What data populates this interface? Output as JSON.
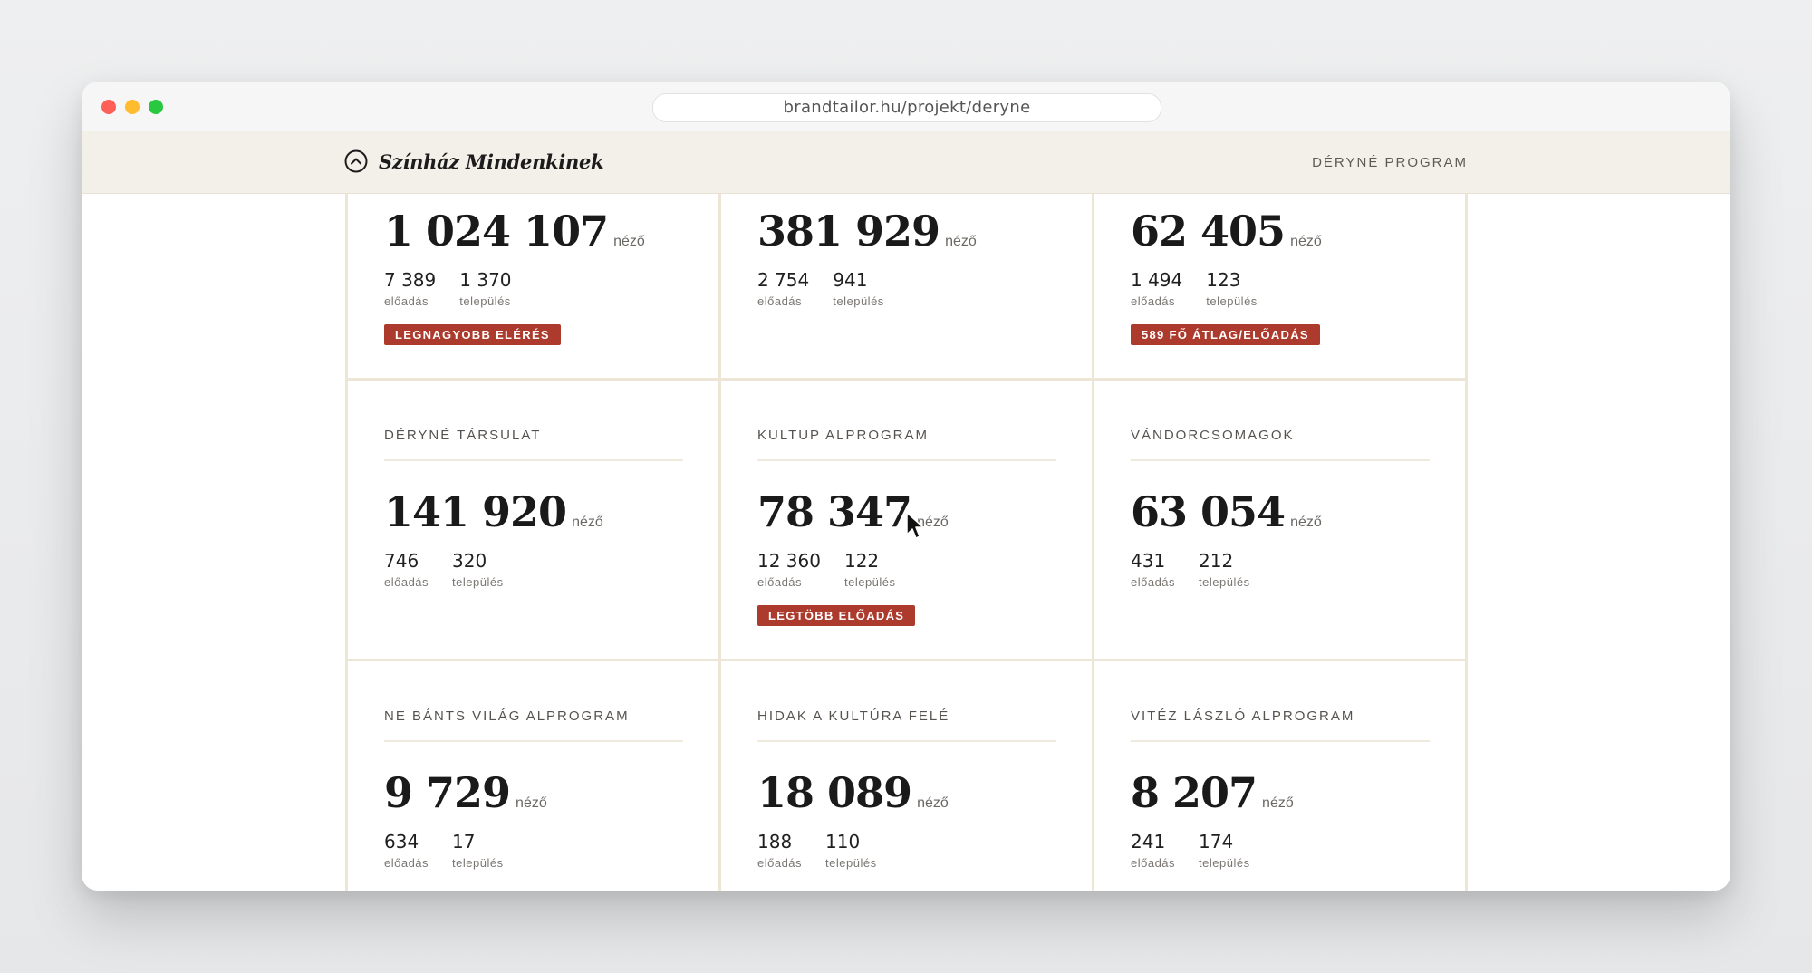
{
  "browser": {
    "url": "brandtailor.hu/projekt/deryne"
  },
  "site": {
    "brand_name": "Színház Mindenkinek",
    "nav_link": "DÉRYNÉ PROGRAM"
  },
  "cards": [
    {
      "title": "",
      "viewers": "1 024 107",
      "unit": "néző",
      "performances": "7 389",
      "performances_label": "előadás",
      "settlements": "1 370",
      "settlements_label": "település",
      "badge": "LEGNAGYOBB ELÉRÉS"
    },
    {
      "title": "",
      "viewers": "381 929",
      "unit": "néző",
      "performances": "2 754",
      "performances_label": "előadás",
      "settlements": "941",
      "settlements_label": "település",
      "badge": ""
    },
    {
      "title": "",
      "viewers": "62 405",
      "unit": "néző",
      "performances": "1 494",
      "performances_label": "előadás",
      "settlements": "123",
      "settlements_label": "település",
      "badge": "589 FŐ ÁTLAG/ELŐADÁS"
    },
    {
      "title": "DÉRYNÉ TÁRSULAT",
      "viewers": "141 920",
      "unit": "néző",
      "performances": "746",
      "performances_label": "előadás",
      "settlements": "320",
      "settlements_label": "település",
      "badge": ""
    },
    {
      "title": "KULTUP ALPROGRAM",
      "viewers": "78 347",
      "unit": "néző",
      "performances": "12 360",
      "performances_label": "előadás",
      "settlements": "122",
      "settlements_label": "település",
      "badge": "LEGTÖBB ELŐADÁS"
    },
    {
      "title": "VÁNDORCSOMAGOK",
      "viewers": "63 054",
      "unit": "néző",
      "performances": "431",
      "performances_label": "előadás",
      "settlements": "212",
      "settlements_label": "település",
      "badge": ""
    },
    {
      "title": "NE BÁNTS VILÁG ALPROGRAM",
      "viewers": "9 729",
      "unit": "néző",
      "performances": "634",
      "performances_label": "előadás",
      "settlements": "17",
      "settlements_label": "település",
      "badge": ""
    },
    {
      "title": "HIDAK A KULTÚRA FELÉ",
      "viewers": "18 089",
      "unit": "néző",
      "performances": "188",
      "performances_label": "előadás",
      "settlements": "110",
      "settlements_label": "település",
      "badge": ""
    },
    {
      "title": "VITÉZ LÁSZLÓ ALPROGRAM",
      "viewers": "8 207",
      "unit": "néző",
      "performances": "241",
      "performances_label": "előadás",
      "settlements": "174",
      "settlements_label": "település",
      "badge": ""
    }
  ],
  "colors": {
    "badge_bg": "#ac3b2d",
    "header_bg": "#f3efe9",
    "card_border": "#ede5d6"
  },
  "icons": {
    "brand": "chevron-up-circle-icon",
    "cursor": "mouse-pointer-icon"
  }
}
